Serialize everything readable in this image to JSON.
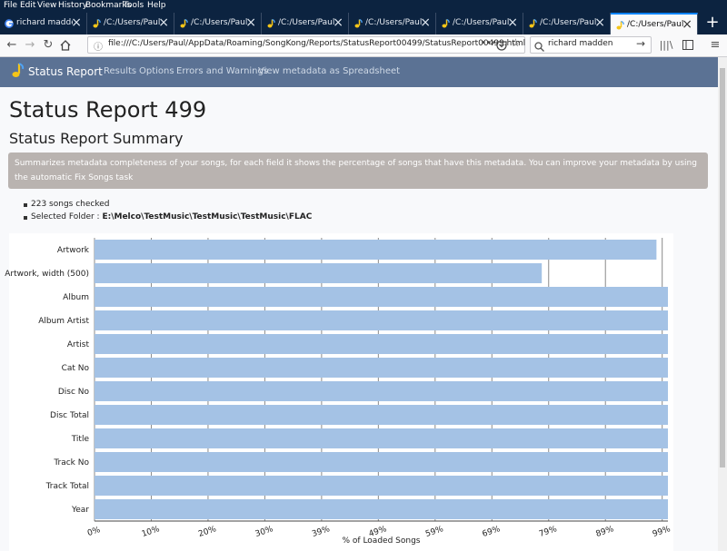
{
  "menu": [
    "File",
    "Edit",
    "View",
    "History",
    "Bookmarks",
    "Tools",
    "Help"
  ],
  "tabs": [
    {
      "label": "richard madden - G",
      "icon": "google-icon"
    },
    {
      "label": "/C:/Users/Paul/Ap",
      "icon": "songkong-icon"
    },
    {
      "label": "/C:/Users/Paul/Ap",
      "icon": "songkong-icon"
    },
    {
      "label": "/C:/Users/Paul/Ap",
      "icon": "songkong-icon"
    },
    {
      "label": "/C:/Users/Paul/Ap",
      "icon": "songkong-icon"
    },
    {
      "label": "/C:/Users/Paul/Ap",
      "icon": "songkong-icon"
    },
    {
      "label": "/C:/Users/Paul/Ap",
      "icon": "songkong-icon"
    },
    {
      "label": "/C:/Users/Paul/Ap",
      "icon": "songkong-icon"
    }
  ],
  "new_tab": "+",
  "url": "file:///C:/Users/Paul/AppData/Roaming/SongKong/Reports/StatusReport00499/StatusReport00499.html",
  "url_more": "•••",
  "search_value": "richard madden",
  "app": {
    "title": "Status Report",
    "nav": [
      "Results",
      "Options",
      "Errors and Warnings",
      "View metadata as Spreadsheet"
    ]
  },
  "page": {
    "title": "Status Report 499",
    "subtitle": "Status Report Summary",
    "info": "Summarizes metadata completeness of your songs, for each field it shows the percentage of songs that have this metadata. You can improve your metadata by using the automatic Fix Songs task",
    "songs_checked": "223 songs checked",
    "folder_label": "Selected Folder : ",
    "folder_value": "E:\\Melco\\TestMusic\\TestMusic\\TestMusic\\FLAC"
  },
  "chart_data": {
    "type": "bar",
    "orientation": "horizontal",
    "categories": [
      "Artwork",
      "Artwork, width (500)",
      "Album",
      "Album Artist",
      "Artist",
      "Cat No",
      "Disc No",
      "Disc Total",
      "Title",
      "Track No",
      "Track Total",
      "Year"
    ],
    "values": [
      98,
      78,
      100,
      100,
      100,
      100,
      100,
      100,
      100,
      100,
      100,
      100
    ],
    "xlabel": "% of Loaded Songs",
    "ylabel": "",
    "xtick_labels": [
      "0%",
      "10%",
      "20%",
      "30%",
      "39%",
      "49%",
      "59%",
      "69%",
      "79%",
      "89%",
      "99%"
    ],
    "xlim": [
      0,
      100
    ],
    "bar_color": "#a4c2e5",
    "grid": true
  }
}
